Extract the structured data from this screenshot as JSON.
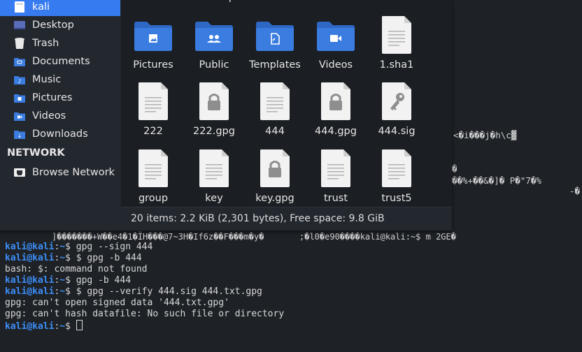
{
  "file_manager": {
    "sidebar": {
      "places": [
        {
          "label": "kali",
          "icon": "home-folder-icon",
          "active": true
        },
        {
          "label": "Desktop",
          "icon": "desktop-icon"
        },
        {
          "label": "Trash",
          "icon": "trash-icon"
        },
        {
          "label": "Documents",
          "icon": "documents-folder-icon"
        },
        {
          "label": "Music",
          "icon": "music-folder-icon"
        },
        {
          "label": "Pictures",
          "icon": "pictures-folder-icon"
        },
        {
          "label": "Videos",
          "icon": "videos-folder-icon"
        },
        {
          "label": "Downloads",
          "icon": "downloads-folder-icon"
        }
      ],
      "network_heading": "NETWORK",
      "browse_network": {
        "label": "Browse Network",
        "icon": "network-icon"
      }
    },
    "top_row_partial": [
      "Γ",
      "Desktop",
      "Documents",
      "Downloads",
      "Music"
    ],
    "files": [
      {
        "name": "Pictures",
        "icon": "pictures-folder-icon"
      },
      {
        "name": "Public",
        "icon": "public-folder-icon"
      },
      {
        "name": "Templates",
        "icon": "templates-folder-icon"
      },
      {
        "name": "Videos",
        "icon": "videos-folder-icon"
      },
      {
        "name": "1.sha1",
        "icon": "text-file-icon"
      },
      {
        "name": "222",
        "icon": "text-file-icon"
      },
      {
        "name": "222.gpg",
        "icon": "encrypted-file-icon"
      },
      {
        "name": "444",
        "icon": "text-file-icon"
      },
      {
        "name": "444.gpg",
        "icon": "encrypted-file-icon"
      },
      {
        "name": "444.sig",
        "icon": "signature-file-icon"
      },
      {
        "name": "group",
        "icon": "text-file-icon"
      },
      {
        "name": "key",
        "icon": "text-file-icon"
      },
      {
        "name": "key.gpg",
        "icon": "encrypted-file-icon"
      },
      {
        "name": "trust",
        "icon": "text-file-icon"
      },
      {
        "name": "trust5",
        "icon": "text-file-icon"
      }
    ],
    "status": "20 items: 2.2 KiB (2,301 bytes), Free space: 9.8 GiB"
  },
  "terminal": {
    "garbage_lines": [
      "<�i���j�h\\c▓",
      "�",
      "��%+��&�]� P�\"7�%",
      "-�",
      "]�������+W��e4�1�ÏH���@7~3H�If6z��F���m�y�       ;�l0�e90����kali@kali:~$ m 2GE�"
    ],
    "prompt_user": "kali@kali",
    "prompt_dir": "~",
    "lines": [
      {
        "prompt": true,
        "text": " gpg --sign 444"
      },
      {
        "prompt": true,
        "text": " $ gpg -b 444"
      },
      {
        "prompt": false,
        "text": "bash: $: command not found"
      },
      {
        "prompt": true,
        "text": " gpg -b 444"
      },
      {
        "prompt": true,
        "text": " $ gpg --verify 444.sig 444.txt.gpg"
      },
      {
        "prompt": false,
        "text": "gpg: can't open signed data '444.txt.gpg'"
      },
      {
        "prompt": false,
        "text": "gpg: can't hash datafile: No such file or directory"
      },
      {
        "prompt": true,
        "text": " "
      }
    ]
  },
  "colors": {
    "accent": "#367bf0",
    "prompt": "#3d8ef8",
    "folder": "#3a7ce0"
  }
}
